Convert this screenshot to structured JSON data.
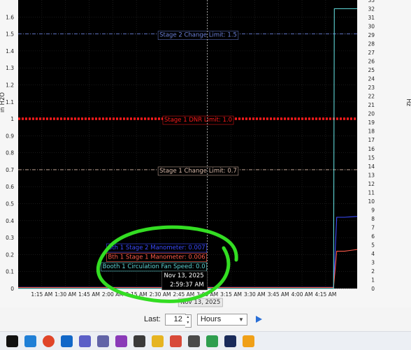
{
  "chart_data": {
    "type": "line",
    "xlabel": "",
    "ylabel": "in H2O",
    "y2label": "Hz",
    "x_ticks": [
      "1:15 AM",
      "1:30 AM",
      "1:45 AM",
      "2:00 AM",
      "2:15 AM",
      "2:30 AM",
      "2:45 AM",
      "3:00 AM",
      "3:15 AM",
      "3:30 AM",
      "3:45 AM",
      "4:00 AM",
      "4:15 AM"
    ],
    "x_range_minutes": [
      60,
      275
    ],
    "ylim": [
      0,
      1.7
    ],
    "y_ticks": [
      "0",
      "0.1",
      "0.2",
      "0.3",
      "0.4",
      "0.5",
      "0.6",
      "0.7",
      "0.8",
      "0.9",
      "1",
      "1.1",
      "1.2",
      "1.3",
      "1.4",
      "1.5",
      "1.6"
    ],
    "y2lim": [
      0,
      33
    ],
    "y2_ticks": [
      "0",
      "1",
      "2",
      "3",
      "4",
      "5",
      "6",
      "7",
      "8",
      "9",
      "10",
      "11",
      "12",
      "13",
      "14",
      "15",
      "16",
      "17",
      "18",
      "19",
      "20",
      "21",
      "22",
      "23",
      "24",
      "25",
      "26",
      "27",
      "28",
      "29",
      "30",
      "31",
      "32",
      "33"
    ],
    "grid": true,
    "limit_lines": [
      {
        "label": "Stage 2 Change Limit: 1.5",
        "value": 1.5,
        "color": "#6a7fd8",
        "style": "dashdot"
      },
      {
        "label": "Stage 1 DNR Limit: 1.0",
        "value": 1.0,
        "color": "#ff1a1a",
        "style": "thick-dotted"
      },
      {
        "label": "Stage 1 Change Limit: 0.7",
        "value": 0.7,
        "color": "#d8b8a8",
        "style": "dashdot"
      }
    ],
    "series": [
      {
        "name": "Bth 1 Stage 2 Manometer",
        "color": "#3a4bff",
        "axis": "left",
        "x": [
          60,
          254,
          260,
          262,
          267,
          275
        ],
        "y": [
          0.007,
          0.007,
          0.007,
          0.42,
          0.42,
          0.425
        ]
      },
      {
        "name": "Bth 1 Stage 1 Manometer",
        "color": "#ff5a4a",
        "axis": "left",
        "x": [
          60,
          254,
          260,
          262,
          267,
          275
        ],
        "y": [
          0.006,
          0.006,
          0.006,
          0.22,
          0.22,
          0.23
        ]
      },
      {
        "name": "Booth 1 Circulation Fan Speed",
        "color": "#5fd6d6",
        "axis": "right",
        "x": [
          60,
          260,
          260.5,
          275
        ],
        "y": [
          0,
          0,
          32,
          32
        ]
      }
    ],
    "cursor": {
      "x": 180,
      "readouts": [
        {
          "text": "Bth 1 Stage 2 Manometer: 0.007",
          "color": "#3a4bff"
        },
        {
          "text": "Bth 1 Stage 1 Manometer: 0.006",
          "color": "#ff5a4a"
        },
        {
          "text": "Booth 1 Circulation Fan Speed: 0.0",
          "color": "#5fd6d6"
        }
      ],
      "date": "Nov 13, 2025",
      "time": "2:59:37 AM",
      "axis_date": "Nov 13, 2025"
    },
    "annotation_color": "#33dd22"
  },
  "controls": {
    "last_label": "Last:",
    "count": "12",
    "unit": "Hours"
  },
  "taskbar": {
    "icons": [
      "windows-start-icon",
      "edge-icon",
      "chrome-icon",
      "outlook-icon",
      "teams-icon",
      "teams-alt-icon",
      "app-icon",
      "app-icon",
      "file-explorer-icon",
      "snip-icon",
      "calculator-icon",
      "photos-icon",
      "app-check-icon",
      "app-icon"
    ]
  }
}
